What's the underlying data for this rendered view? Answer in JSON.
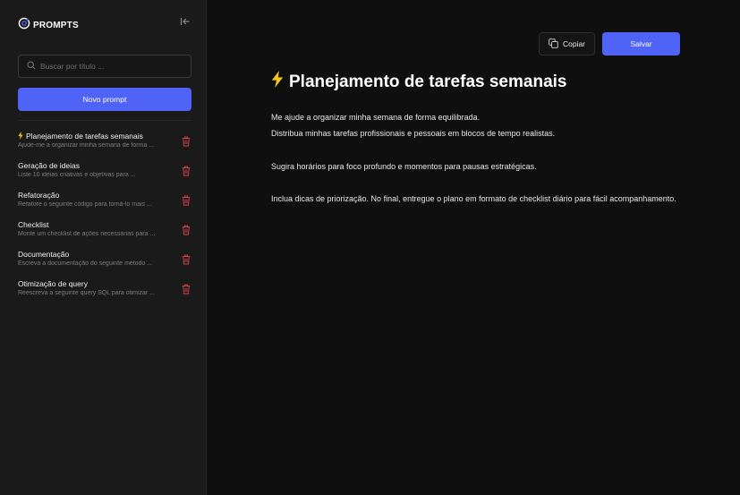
{
  "app": {
    "logo_text": "PROMPTS"
  },
  "sidebar": {
    "search_placeholder": "Buscar por título ...",
    "new_button": "Novo prompt",
    "items": [
      {
        "title": "Planejamento de tarefas semanais",
        "desc": "Ajude-me a organizar minha semana de forma ...",
        "icon": "lightning-icon"
      },
      {
        "title": "Geração de ideias",
        "desc": "Liste 10 ideias criativas e objetivas para ..."
      },
      {
        "title": "Refatoração",
        "desc": "Refatore o seguinte código para torná-lo mais ..."
      },
      {
        "title": "Checklist",
        "desc": "Monte um checklist de ações necessárias para ..."
      },
      {
        "title": "Documentação",
        "desc": "Escreva a documentação do seguinte método ..."
      },
      {
        "title": "Otimização de query",
        "desc": "Reescreva a seguinte query SQL para otimizar ..."
      }
    ]
  },
  "toolbar": {
    "copy_label": "Copiar",
    "save_label": "Salvar"
  },
  "editor": {
    "title": "Planejamento de tarefas semanais",
    "lines": [
      "Me ajude a organizar minha semana de forma equilibrada.",
      "Distribua minhas tarefas profissionais e pessoais em blocos de tempo realistas.",
      "",
      "Sugira horários para foco profundo e momentos para pausas estratégicas.",
      "",
      "Inclua dicas de priorização. No final, entregue o plano em formato de checklist diário para fácil acompanhamento."
    ]
  },
  "colors": {
    "accent": "#4f63f6",
    "danger": "#d9434f",
    "lightning": "#f5c518"
  }
}
